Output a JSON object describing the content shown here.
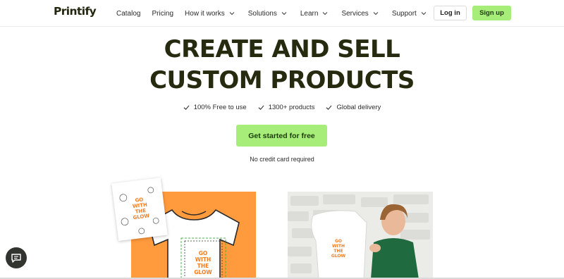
{
  "brand": {
    "logo_text": "Printify",
    "accent_green": "#a6ee79",
    "accent_orange": "#ff9a3d",
    "headline_color": "#262a0e"
  },
  "nav": {
    "items": [
      {
        "label": "Catalog",
        "has_dropdown": false
      },
      {
        "label": "Pricing",
        "has_dropdown": false
      },
      {
        "label": "How it works",
        "has_dropdown": true
      },
      {
        "label": "Solutions",
        "has_dropdown": true
      },
      {
        "label": "Learn",
        "has_dropdown": true
      },
      {
        "label": "Services",
        "has_dropdown": true
      },
      {
        "label": "Support",
        "has_dropdown": true
      }
    ],
    "login_label": "Log in",
    "signup_label": "Sign up"
  },
  "hero": {
    "headline_line1": "CREATE AND SELL",
    "headline_line2": "CUSTOM PRODUCTS",
    "features": [
      {
        "label": "100% Free to use",
        "icon": "check-icon"
      },
      {
        "label": "1300+ products",
        "icon": "check-icon"
      },
      {
        "label": "Global delivery",
        "icon": "check-icon"
      }
    ],
    "cta_label": "Get started for free",
    "note": "No credit card required"
  },
  "images": {
    "design_text": "GO WITH THE GLOW"
  },
  "chat": {
    "icon": "chat-icon"
  }
}
